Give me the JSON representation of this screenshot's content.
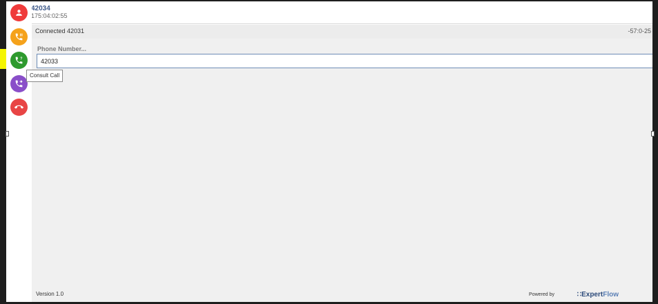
{
  "header": {
    "caller_name": "42034",
    "caller_time": "175:04:02:55"
  },
  "status": {
    "connected_text": "Connected 42031",
    "timer": "-57:0-25"
  },
  "consult": {
    "phone_label": "Phone Number...",
    "phone_value": "42033"
  },
  "sidebar": {
    "tooltip": "Consult Call",
    "buttons": [
      {
        "name": "caller-avatar",
        "color": "#ef3b3b",
        "icon": "person-icon"
      },
      {
        "name": "hold-button",
        "color": "#f5a21b",
        "icon": "phone-pause-icon"
      },
      {
        "name": "consult-call-button",
        "color": "#2e9a2e",
        "icon": "phone-question-icon"
      },
      {
        "name": "transfer-call-button",
        "color": "#8a4fc9",
        "icon": "phone-transfer-icon"
      },
      {
        "name": "end-call-button",
        "color": "#e84545",
        "icon": "hang-up-icon"
      }
    ]
  },
  "footer": {
    "version": "Version 1.0",
    "powered_by": "Powered by",
    "brand_expert": "Expert",
    "brand_flow": "Flow"
  }
}
